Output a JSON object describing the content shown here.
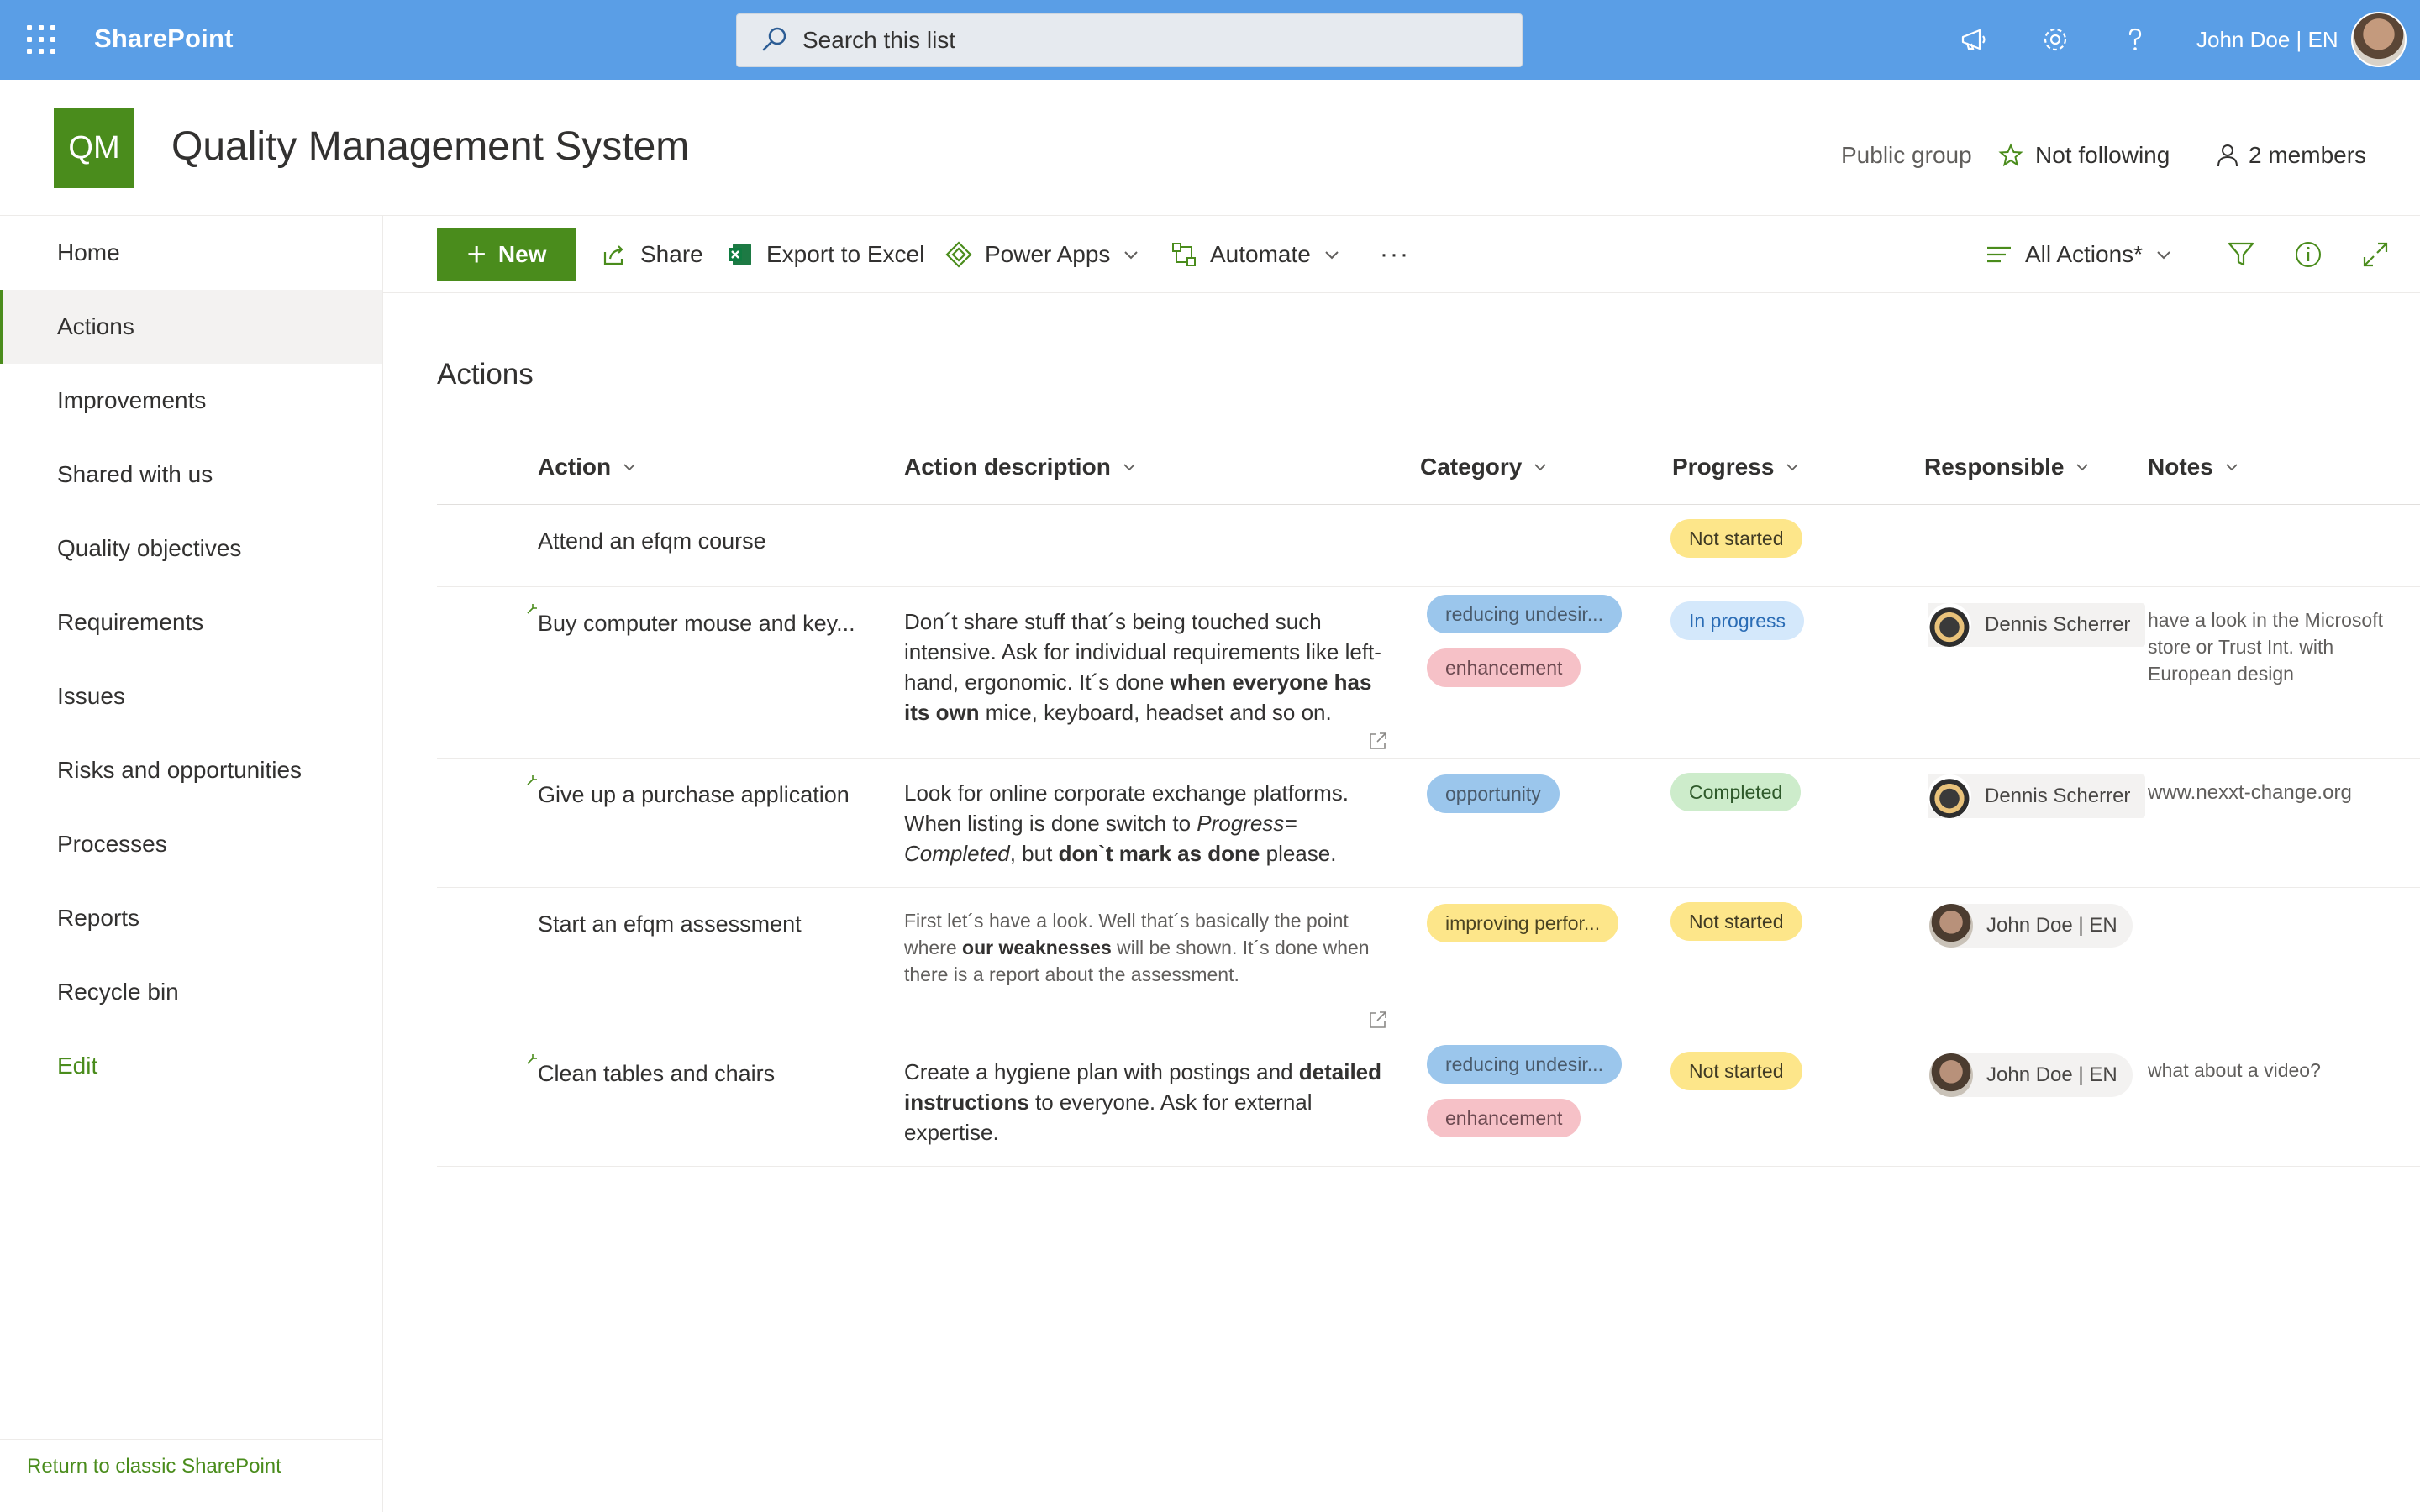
{
  "suitebar": {
    "brand": "SharePoint",
    "search_placeholder": "Search this list",
    "user": "John Doe | EN"
  },
  "site": {
    "logo": "QM",
    "title": "Quality Management System",
    "visibility": "Public group",
    "follow": "Not following",
    "members": "2 members"
  },
  "nav": {
    "items": [
      "Home",
      "Actions",
      "Improvements",
      "Shared with us",
      "Quality objectives",
      "Requirements",
      "Issues",
      "Risks and opportunities",
      "Processes",
      "Reports",
      "Recycle bin",
      "Edit"
    ],
    "selected": "Actions",
    "footer": "Return to classic SharePoint"
  },
  "commandbar": {
    "new": "New",
    "share": "Share",
    "export": "Export to Excel",
    "powerapps": "Power Apps",
    "automate": "Automate",
    "more": "···",
    "view": "All Actions*"
  },
  "list": {
    "title": "Actions",
    "columns": [
      "Action",
      "Action description",
      "Category",
      "Progress",
      "Responsible",
      "Notes"
    ],
    "rows": [
      {
        "action": "Attend an efqm course",
        "progress": "Not started"
      },
      {
        "action": "Buy computer mouse and key...",
        "desc": [
          "Don´t share stuff that´s being touched such intensive. Ask for individual requirements like left-hand, ergonomic. It´s done ",
          "when everyone has its own",
          " mice, keyboard, headset and so on."
        ],
        "categories": [
          "reducing undesir...",
          "enhancement"
        ],
        "progress": "In progress",
        "responsible": "Dennis Scherrer",
        "notes": "have a look in the Microsoft store or Trust Int. with European design"
      },
      {
        "action": "Give up a purchase application",
        "desc": [
          "Look for online corporate exchange platforms. When listing is done switch to ",
          "Progress= Completed",
          ", but ",
          "don`t mark as done",
          " please."
        ],
        "categories": [
          "opportunity"
        ],
        "progress": "Completed",
        "responsible": "Dennis Scherrer",
        "notes": "www.nexxt-change.org"
      },
      {
        "action": "Start an efqm assessment",
        "desc": [
          "First let´s have a look. Well that´s basically the point where ",
          "our weaknesses",
          " will be shown. It´s done when there is a report about the assessment."
        ],
        "categories": [
          "improving perfor..."
        ],
        "progress": "Not started",
        "responsible": "John Doe | EN"
      },
      {
        "action": "Clean tables and chairs",
        "desc": [
          "Create a hygiene plan with postings and ",
          "detailed instructions",
          " to everyone. Ask for external expertise."
        ],
        "categories": [
          "reducing undesir...",
          "enhancement"
        ],
        "progress": "Not started",
        "responsible": "John Doe | EN",
        "notes": "what about a video?"
      }
    ]
  }
}
